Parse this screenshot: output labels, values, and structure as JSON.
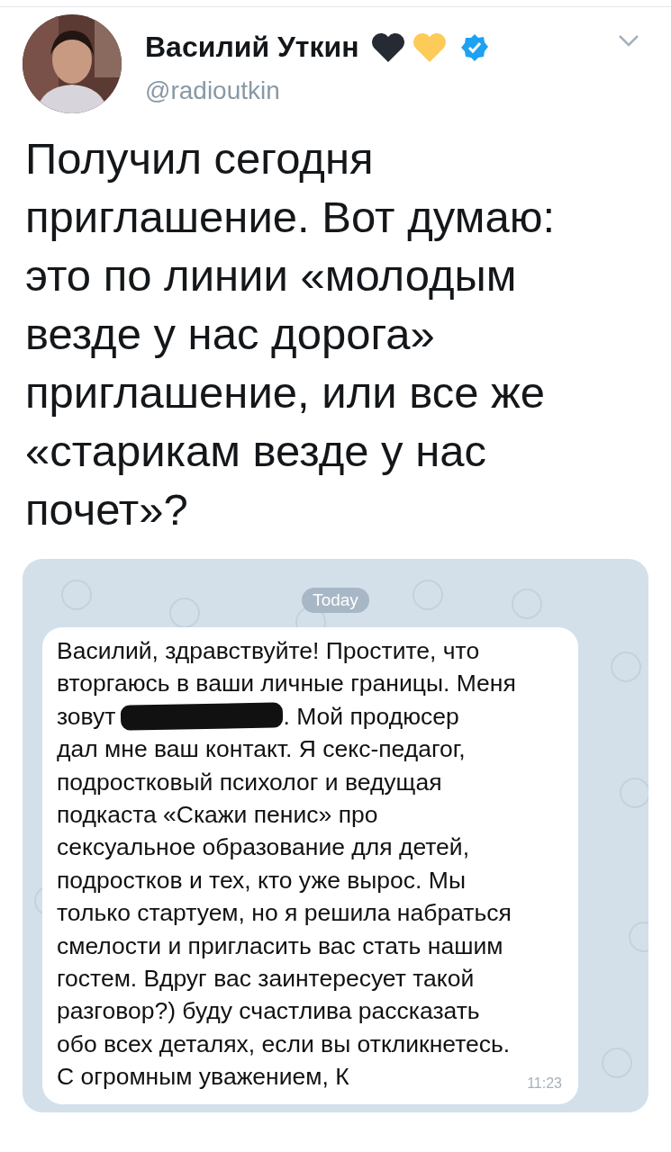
{
  "tweet": {
    "author": {
      "name": "Василий Уткин",
      "handle": "@radioutkin",
      "verified": true
    },
    "text_lines": [
      "Получил сегодня",
      "приглашение. Вот думаю:",
      "это по линии «молодым",
      "везде у нас дорога»",
      "приглашение, или все же",
      "«старикам везде у нас",
      "почет»?"
    ]
  },
  "chat": {
    "date_badge": "Today",
    "message": {
      "lines": [
        {
          "text": "Василий, здравствуйте! Простите, что"
        },
        {
          "text": "вторгаюсь в ваши личные границы. Меня"
        },
        {
          "text": "зовут",
          "redacted": true,
          "after": ". Мой продюсер"
        },
        {
          "text": "дал мне ваш контакт. Я секс-педагог,"
        },
        {
          "text": "подростковый психолог и ведущая"
        },
        {
          "text": "подкаста «Скажи пенис» про"
        },
        {
          "text": "сексуальное образование для детей,"
        },
        {
          "text": "подростков и тех, кто уже вырос. Мы"
        },
        {
          "text": "только стартуем, но я решила набраться"
        },
        {
          "text": "смелости и пригласить вас стать нашим"
        },
        {
          "text": "гостем. Вдруг вас заинтересует такой"
        },
        {
          "text": "разговор?) буду счастлива рассказать"
        },
        {
          "text": "обо всех деталях, если вы откликнетесь."
        },
        {
          "text": "С огромным уважением, К"
        }
      ],
      "time": "11:23"
    }
  }
}
